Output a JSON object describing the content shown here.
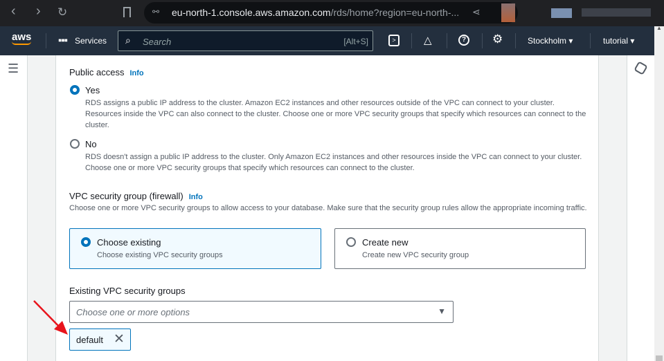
{
  "browser": {
    "url_host": "eu-north-1.console.aws.amazon.com",
    "url_path": "/rds/home?region=eu-north-..."
  },
  "topnav": {
    "logo": "aws",
    "services": "Services",
    "search_placeholder": "Search",
    "search_shortcut": "[Alt+S]",
    "region": "Stockholm",
    "account": "tutorial"
  },
  "public_access": {
    "label": "Public access",
    "info": "Info",
    "options": [
      {
        "label": "Yes",
        "selected": true,
        "description": "RDS assigns a public IP address to the cluster. Amazon EC2 instances and other resources outside of the VPC can connect to your cluster. Resources inside the VPC can also connect to the cluster. Choose one or more VPC security groups that specify which resources can connect to the cluster."
      },
      {
        "label": "No",
        "selected": false,
        "description": "RDS doesn't assign a public IP address to the cluster. Only Amazon EC2 instances and other resources inside the VPC can connect to your cluster. Choose one or more VPC security groups that specify which resources can connect to the cluster."
      }
    ]
  },
  "vpc_sg": {
    "label": "VPC security group (firewall)",
    "info": "Info",
    "description": "Choose one or more VPC security groups to allow access to your database. Make sure that the security group rules allow the appropriate incoming traffic.",
    "tiles": [
      {
        "label": "Choose existing",
        "description": "Choose existing VPC security groups",
        "selected": true
      },
      {
        "label": "Create new",
        "description": "Create new VPC security group",
        "selected": false
      }
    ]
  },
  "existing": {
    "label": "Existing VPC security groups",
    "placeholder": "Choose one or more options",
    "tokens": [
      "default"
    ]
  }
}
